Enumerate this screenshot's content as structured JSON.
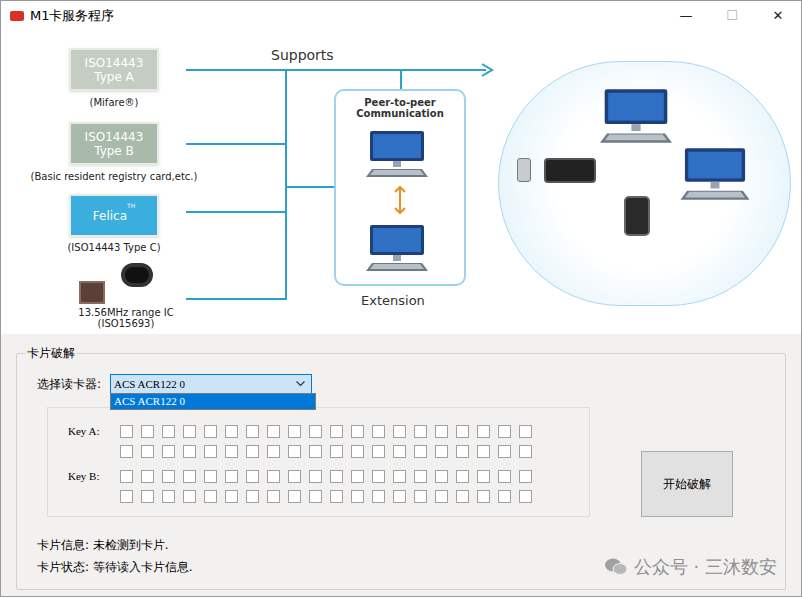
{
  "window": {
    "title": "M1卡服务程序",
    "controls": [
      "—",
      "☐",
      "✕"
    ]
  },
  "diagram": {
    "supports_label": "Supports",
    "standards": [
      {
        "lines": [
          "ISO14443",
          "Type A"
        ],
        "caption": "(Mifare®)",
        "color": "#c5cdc3"
      },
      {
        "lines": [
          "ISO14443",
          "Type B"
        ],
        "caption": "(Basic resident registry card,etc.)",
        "color": "#a9b9aa"
      },
      {
        "lines": [
          "Felica"
        ],
        "sup": "TH",
        "caption": "(ISO14443 Type C)",
        "color": "#3aaedc"
      }
    ],
    "ic": {
      "captions": [
        "13.56MHz range IC",
        "(ISO15693)"
      ]
    },
    "peer": {
      "title_lines": [
        "Peer-to-peer",
        "Communication"
      ],
      "label": "Extension"
    }
  },
  "group": {
    "title": "卡片破解",
    "reader": {
      "label": "选择读卡器:",
      "value": "ACS ACR122 0",
      "expanded": true,
      "options": [
        {
          "label": "ACS ACR122 0",
          "selected": true
        }
      ]
    },
    "keys": [
      {
        "label": "Key A:",
        "rows": [
          [
            false,
            false,
            false,
            false,
            false,
            false,
            false,
            false,
            false,
            false,
            false,
            false,
            false,
            false,
            false,
            false,
            false,
            false,
            false,
            false
          ],
          [
            false,
            false,
            false,
            false,
            false,
            false,
            false,
            false,
            false,
            false,
            false,
            false,
            false,
            false,
            false,
            false,
            false,
            false,
            false,
            false
          ]
        ]
      },
      {
        "label": "Key B:",
        "rows": [
          [
            false,
            false,
            false,
            false,
            false,
            false,
            false,
            false,
            false,
            false,
            false,
            false,
            false,
            false,
            false,
            false,
            false,
            false,
            false,
            false
          ],
          [
            false,
            false,
            false,
            false,
            false,
            false,
            false,
            false,
            false,
            false,
            false,
            false,
            false,
            false,
            false,
            false,
            false,
            false,
            false,
            false
          ]
        ]
      }
    ],
    "button": "开始破解",
    "info": [
      "卡片信息: 未检测到卡片.",
      "卡片状态: 等待读入卡片信息."
    ]
  },
  "watermark": "公众号 · 三沐数安"
}
